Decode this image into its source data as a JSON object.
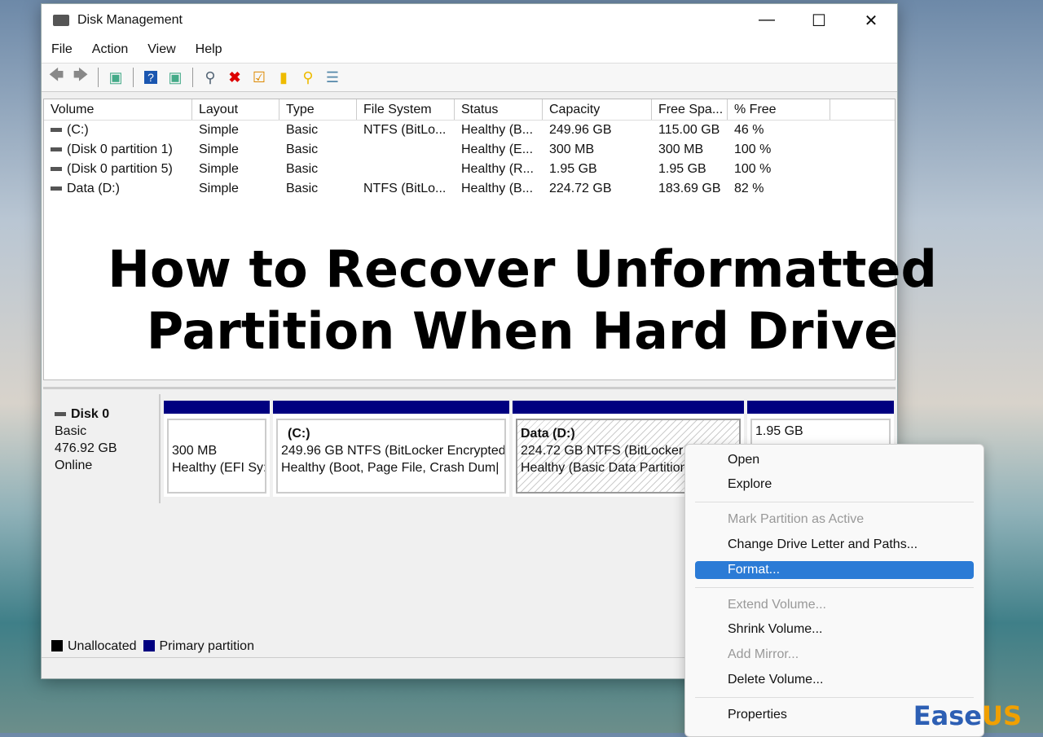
{
  "window": {
    "title": "Disk Management",
    "minimize": "—",
    "maximize": "☐",
    "close": "✕"
  },
  "menu": [
    "File",
    "Action",
    "View",
    "Help"
  ],
  "toolbar_icons": [
    "back-icon",
    "forward-icon",
    "console-tree-icon",
    "help-icon",
    "action-pane-icon",
    "connect-disk-icon",
    "delete-icon",
    "properties-icon",
    "open-folder-icon",
    "explore-icon",
    "settings-list-icon"
  ],
  "columns": [
    "Volume",
    "Layout",
    "Type",
    "File System",
    "Status",
    "Capacity",
    "Free Spa...",
    "% Free"
  ],
  "volumes": [
    [
      "(C:)",
      "Simple",
      "Basic",
      "NTFS (BitLo...",
      "Healthy (B...",
      "249.96 GB",
      "115.00 GB",
      "46 %"
    ],
    [
      "(Disk 0 partition 1)",
      "Simple",
      "Basic",
      "",
      "Healthy (E...",
      "300 MB",
      "300 MB",
      "100 %"
    ],
    [
      "(Disk 0 partition 5)",
      "Simple",
      "Basic",
      "",
      "Healthy (R...",
      "1.95 GB",
      "1.95 GB",
      "100 %"
    ],
    [
      "Data (D:)",
      "Simple",
      "Basic",
      "NTFS (BitLo...",
      "Healthy (B...",
      "224.72 GB",
      "183.69 GB",
      "82 %"
    ]
  ],
  "overlay": {
    "line1": "How to Recover Unformatted",
    "line2": "Partition When Hard Drive"
  },
  "disk": {
    "name": "Disk 0",
    "type": "Basic",
    "size": "476.92 GB",
    "state": "Online"
  },
  "partitions": [
    {
      "title": "",
      "line1": "300 MB",
      "line2": "Healthy (EFI Sy:"
    },
    {
      "title": "(C:)",
      "line1": "249.96 GB NTFS (BitLocker Encrypted",
      "line2": "Healthy (Boot, Page File, Crash Dum|"
    },
    {
      "title": "Data  (D:)",
      "line1": "224.72 GB NTFS (BitLocker Encrypted",
      "line2": "Healthy (Basic Data Partition)"
    },
    {
      "title": "",
      "line1": "1.95 GB",
      "line2": ""
    }
  ],
  "legend": {
    "unallocated": "Unallocated",
    "primary": "Primary partition"
  },
  "context_menu": [
    "Open",
    "Explore",
    "Mark Partition as Active",
    "Change Drive Letter and Paths...",
    "Format...",
    "Extend Volume...",
    "Shrink Volume...",
    "Add Mirror...",
    "Delete Volume...",
    "Properties"
  ],
  "logo": {
    "a": "Ease",
    "b": "US"
  },
  "colors": {
    "primary": "#000080",
    "selection": "#2b7bd6"
  }
}
